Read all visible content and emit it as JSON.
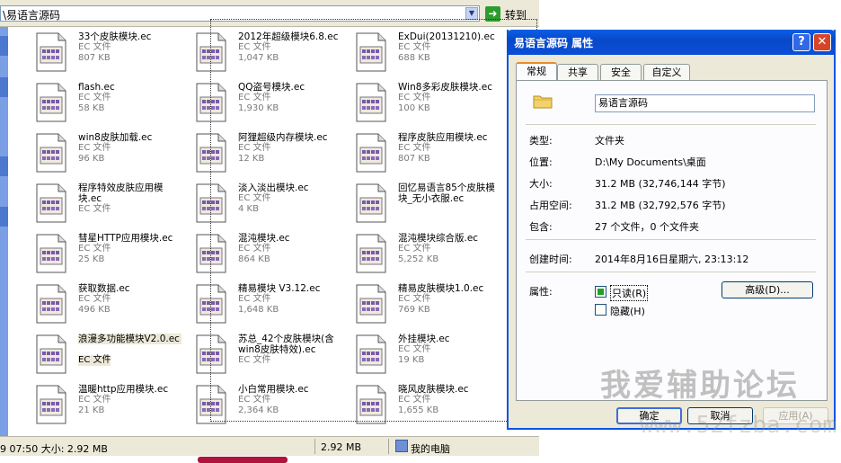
{
  "address": {
    "path": "\\易语言源码",
    "go_label": "转到"
  },
  "files": [
    {
      "name": "33个皮肤模块.ec",
      "type": "EC 文件",
      "size": "807 KB"
    },
    {
      "name": "2012年超级模块6.8.ec",
      "type": "EC 文件",
      "size": "1,047 KB"
    },
    {
      "name": "ExDui(20131210).ec",
      "type": "EC 文件",
      "size": "688 KB"
    },
    {
      "name": "flash.ec",
      "type": "EC 文件",
      "size": "58 KB"
    },
    {
      "name": "QQ盗号模块.ec",
      "type": "EC 文件",
      "size": "1,930 KB"
    },
    {
      "name": "Win8多彩皮肤模块.ec",
      "type": "EC 文件",
      "size": "100 KB"
    },
    {
      "name": "win8皮肤加载.ec",
      "type": "EC 文件",
      "size": "96 KB"
    },
    {
      "name": "阿狸超级内存模块.ec",
      "type": "EC 文件",
      "size": "12 KB"
    },
    {
      "name": "程序皮肤应用模块.ec",
      "type": "EC 文件",
      "size": "807 KB"
    },
    {
      "name": "程序特效皮肤应用模块.ec",
      "type": "EC 文件",
      "size": ""
    },
    {
      "name": "淡入淡出模块.ec",
      "type": "EC 文件",
      "size": "4 KB"
    },
    {
      "name": "回忆易语言85个皮肤模块_无小衣服.ec",
      "type": "",
      "size": ""
    },
    {
      "name": "彗星HTTP应用模块.ec",
      "type": "EC 文件",
      "size": "25 KB"
    },
    {
      "name": "混沌模块.ec",
      "type": "EC 文件",
      "size": "864 KB"
    },
    {
      "name": "混沌模块综合版.ec",
      "type": "EC 文件",
      "size": "5,252 KB"
    },
    {
      "name": "获取数据.ec",
      "type": "EC 文件",
      "size": "496 KB"
    },
    {
      "name": "精易模块 V3.12.ec",
      "type": "EC 文件",
      "size": "1,648 KB"
    },
    {
      "name": "精易皮肤模块1.0.ec",
      "type": "EC 文件",
      "size": "769 KB"
    },
    {
      "name": "浪漫多功能模块V2.0.ec",
      "type": "EC 文件",
      "size": ""
    },
    {
      "name": "苏总_42个皮肤模块(含win8皮肤特效).ec",
      "type": "EC 文件",
      "size": ""
    },
    {
      "name": "外挂模块.ec",
      "type": "EC 文件",
      "size": "19 KB"
    },
    {
      "name": "温暖http应用模块.ec",
      "type": "EC 文件",
      "size": "21 KB"
    },
    {
      "name": "小白常用模块.ec",
      "type": "EC 文件",
      "size": "2,364 KB"
    },
    {
      "name": "晓风皮肤模块.ec",
      "type": "EC 文件",
      "size": "1,655 KB"
    }
  ],
  "status": {
    "time_size": "9 07:50 大小: 2.92 MB",
    "total": "2.92 MB",
    "location": "我的电脑"
  },
  "dialog": {
    "title": "易语言源码 属性",
    "tabs": [
      "常规",
      "共享",
      "安全",
      "自定义"
    ],
    "name": "易语言源码",
    "props": [
      {
        "label": "类型:",
        "value": "文件夹"
      },
      {
        "label": "位置:",
        "value": "D:\\My Documents\\桌面"
      },
      {
        "label": "大小:",
        "value": "31.2 MB (32,746,144 字节)"
      },
      {
        "label": "占用空间:",
        "value": "31.2 MB (32,792,576 字节)"
      },
      {
        "label": "包含:",
        "value": "27 个文件，0 个文件夹"
      },
      {
        "label": "创建时间:",
        "value": "2014年8月16日星期六, 23:13:12"
      },
      {
        "label": "属性:",
        "value": ""
      }
    ],
    "readonly_label": "只读(R)",
    "hidden_label": "隐藏(H)",
    "advanced_label": "高级(D)...",
    "ok_label": "确定",
    "cancel_label": "取消",
    "apply_label": "应用(A)"
  },
  "watermark": {
    "line1": "我爱辅助论坛",
    "line2": "www.52fzba.com"
  }
}
